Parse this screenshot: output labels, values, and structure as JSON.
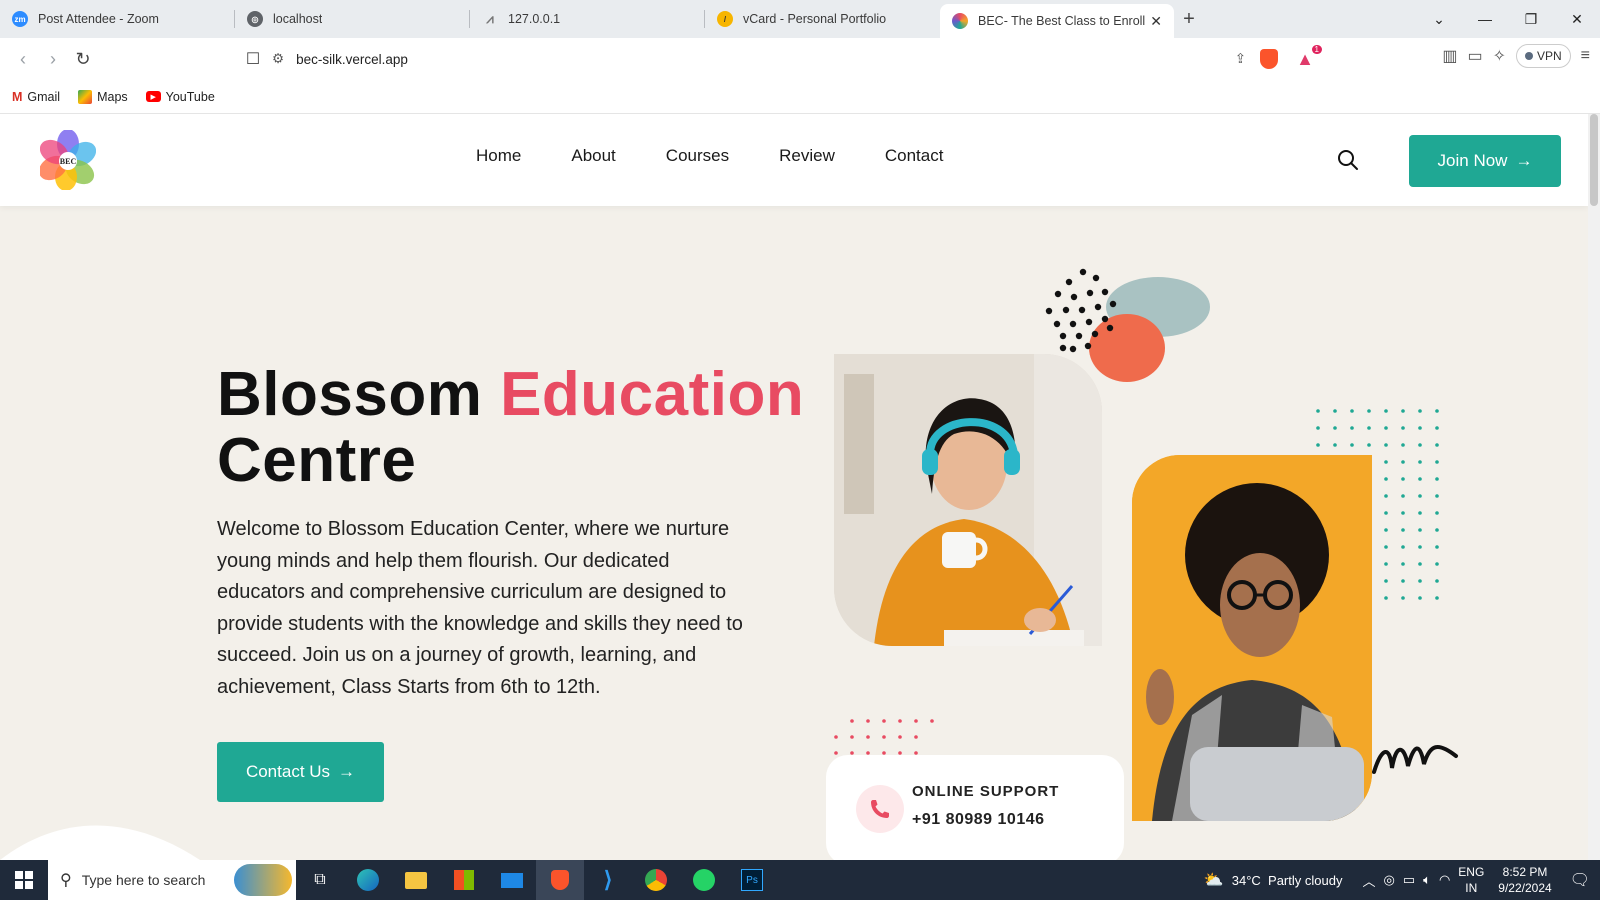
{
  "browser": {
    "tabs": [
      {
        "label": "Post Attendee - Zoom",
        "icon": "zoom-icon",
        "color": "#2d8cff"
      },
      {
        "label": "localhost",
        "icon": "globe-icon",
        "color": "#5f6368"
      },
      {
        "label": "127.0.0.1",
        "icon": "flask-icon",
        "color": "#888888"
      },
      {
        "label": "vCard - Personal Portfolio",
        "icon": "vcard-icon",
        "color": "#f7b500"
      },
      {
        "label": "BEC- The Best Class to Enroll fo",
        "icon": "bec-icon",
        "color": "#6a5acd",
        "active": true
      }
    ],
    "url": "bec-silk.vercel.app",
    "vpn_label": "VPN",
    "notification_count": "1",
    "bookmarks": [
      {
        "label": "Gmail",
        "icon": "gmail-icon"
      },
      {
        "label": "Maps",
        "icon": "maps-icon"
      },
      {
        "label": "YouTube",
        "icon": "youtube-icon"
      }
    ]
  },
  "site": {
    "logo_text": "BEC",
    "nav": [
      "Home",
      "About",
      "Courses",
      "Review",
      "Contact"
    ],
    "join_label": "Join Now",
    "hero_title_1": "Blossom ",
    "hero_title_accent": "Education",
    "hero_title_2": "Centre",
    "hero_text": "Welcome to Blossom Education Center, where we nurture young minds and help them flourish. Our dedicated educators and comprehensive curriculum are designed to provide students with the knowledge and skills they need to succeed. Join us on a journey of growth, learning, and achievement, Class Starts from 6th to 12th.",
    "contact_label": "Contact Us",
    "support_title": "ONLINE SUPPORT",
    "support_phone": "+91 80989 10146",
    "colors": {
      "accent": "#e84b62",
      "primary": "#1fa894",
      "orange": "#f3a728"
    }
  },
  "taskbar": {
    "search_placeholder": "Type here to search",
    "weather": "34°C  Partly cloudy",
    "lang_1": "ENG",
    "lang_2": "IN",
    "time": "8:52 PM",
    "date": "9/22/2024"
  }
}
